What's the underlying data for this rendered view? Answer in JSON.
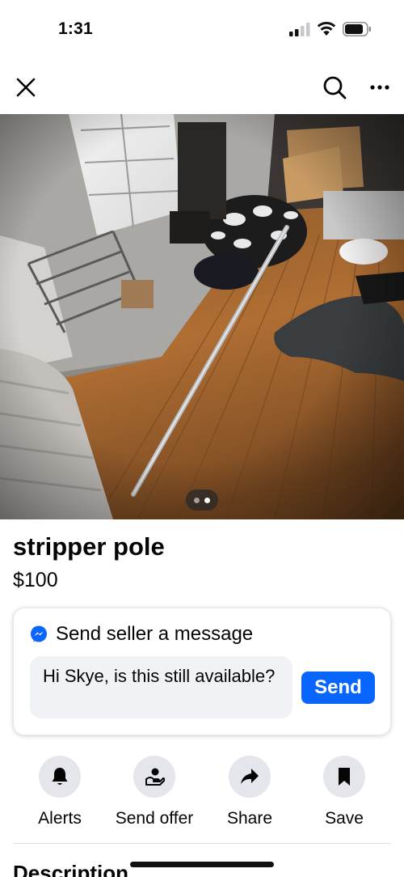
{
  "status_bar": {
    "time": "1:31"
  },
  "nav": {
    "icons": [
      "close-icon",
      "search-icon",
      "more-icon"
    ]
  },
  "photo": {
    "pages": 2,
    "current_page": 1
  },
  "listing": {
    "title": "stripper pole",
    "price": "$100"
  },
  "message": {
    "header": "Send seller a message",
    "input_value": "Hi Skye, is this still available?",
    "send_label": "Send"
  },
  "actions": [
    {
      "label": "Alerts",
      "icon": "bell-icon"
    },
    {
      "label": "Send offer",
      "icon": "offer-icon"
    },
    {
      "label": "Share",
      "icon": "share-icon"
    },
    {
      "label": "Save",
      "icon": "bookmark-icon"
    }
  ],
  "description": {
    "heading": "Description"
  },
  "colors": {
    "accent": "#0866ff",
    "action_bg": "#e4e6eb",
    "input_bg": "#f0f2f5"
  }
}
